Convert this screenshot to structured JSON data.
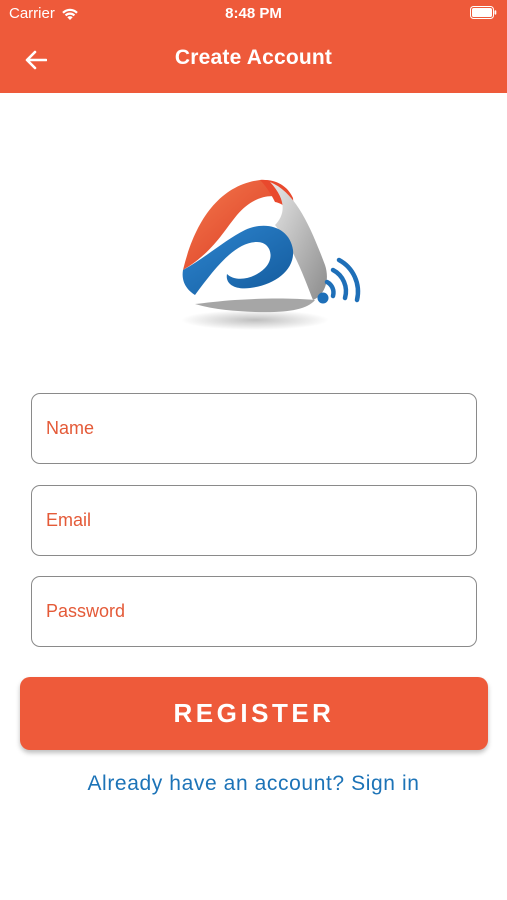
{
  "status_bar": {
    "carrier": "Carrier",
    "time": "8:48 PM"
  },
  "nav": {
    "title": "Create Account",
    "back_icon": "arrow-left-icon"
  },
  "form": {
    "name_placeholder": "Name",
    "email_placeholder": "Email",
    "password_placeholder": "Password"
  },
  "actions": {
    "register_label": "REGISTER",
    "signin_link": "Already have an account? Sign in"
  },
  "colors": {
    "brand_orange": "#EE5A3A",
    "link_blue": "#1C73B7",
    "logo_blue": "#1E6FB8",
    "logo_gray": "#9A9A9A"
  }
}
